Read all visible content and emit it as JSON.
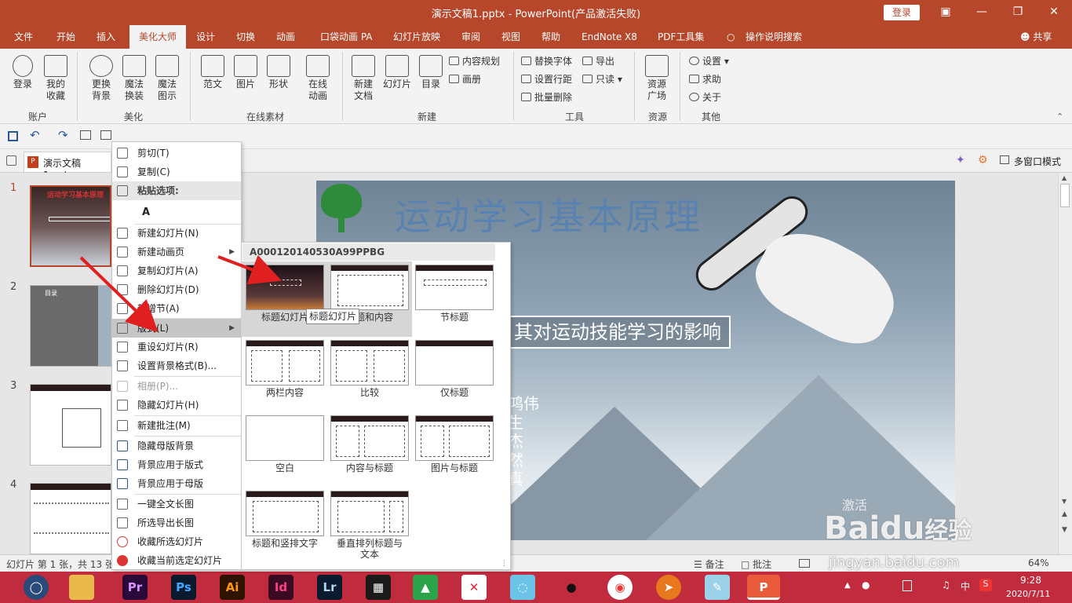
{
  "titlebar": {
    "title": "演示文稿1.pptx  -  PowerPoint(产品激活失败)",
    "login": "登录"
  },
  "menu": {
    "tabs": [
      "文件",
      "开始",
      "插入",
      "美化大师",
      "设计",
      "切换",
      "动画",
      "口袋动画 PA",
      "幻灯片放映",
      "审阅",
      "视图",
      "帮助",
      "EndNote X8",
      "PDF工具集"
    ],
    "search": "操作说明搜索",
    "share": "共享"
  },
  "ribbon": {
    "account": {
      "login": "登录",
      "favorites": "我的\n收藏",
      "label": "账户"
    },
    "beautify": {
      "change_bg": "更换\n背景",
      "magic_change": "魔法\n换装",
      "magic_icon": "魔法\n图示",
      "label": "美化"
    },
    "material": {
      "template": "范文",
      "image": "图片",
      "shape": "形状",
      "online_anim": "在线\n动画",
      "label": "在线素材"
    },
    "new": {
      "new_doc": "新建\n文档",
      "slide": "幻灯片",
      "toc": "目录",
      "content_plan": "内容规划",
      "album": "画册",
      "label": "新建"
    },
    "tools": {
      "replace_font": "替换字体",
      "export": "导出",
      "line_spacing": "设置行距",
      "readonly": "只读",
      "batch_delete": "批量删除",
      "label": "工具"
    },
    "resources": {
      "square": "资源\n广场",
      "label": "资源"
    },
    "other": {
      "settings": "设置",
      "help": "求助",
      "about": "关于",
      "label": "其他"
    }
  },
  "doctab": {
    "filename": "演示文稿1.pptx",
    "multiwindow": "多窗口模式"
  },
  "thumbs": [
    {
      "num": "1",
      "title": "运动学习基本原理"
    },
    {
      "num": "2",
      "title": "目录"
    },
    {
      "num": "3",
      "title": ""
    },
    {
      "num": "4",
      "title": ""
    }
  ],
  "slide": {
    "title": "运动学习基本原理",
    "subtitle": "其对运动技能学习的影响",
    "names": [
      "鸿伟",
      "生",
      "杰",
      "然",
      "真"
    ]
  },
  "context_menu": {
    "items": [
      "剪切(T)",
      "复制(C)",
      "粘贴选项:",
      "新建幻灯片(N)",
      "新建动画页",
      "复制幻灯片(A)",
      "删除幻灯片(D)",
      "新增节(A)",
      "版式(L)",
      "重设幻灯片(R)",
      "设置背景格式(B)...",
      "相册(P)...",
      "隐藏幻灯片(H)",
      "新建批注(M)",
      "隐藏母版背景",
      "背景应用于版式",
      "背景应用于母版",
      "一键全文长图",
      "所选导出长图",
      "收藏所选幻灯片",
      "收藏当前选定幻灯片"
    ],
    "paste_glyph": "A"
  },
  "submenu": {
    "header": "A000120140530A99PPBG",
    "layouts": [
      "标题幻灯片",
      "标题和内容",
      "节标题",
      "两栏内容",
      "比较",
      "仅标题",
      "空白",
      "内容与标题",
      "图片与标题",
      "标题和竖排文字",
      "垂直排列标题与\n文本"
    ],
    "tooltip": "标题幻灯片"
  },
  "status": {
    "slide_info": "幻灯片 第 1 张，共 13 张",
    "notes": "备注",
    "comments": "批注",
    "zoom": "64%"
  },
  "taskbar": {
    "time": "9:28",
    "date": "2020/7/11",
    "ime": "中",
    "apps": [
      "Pr",
      "Ps",
      "Ai",
      "Id",
      "Lr"
    ]
  },
  "watermark": {
    "activate": "激活",
    "brand": "Baidu",
    "brand_cn": "经验",
    "url": "jingyan.baidu.com"
  }
}
